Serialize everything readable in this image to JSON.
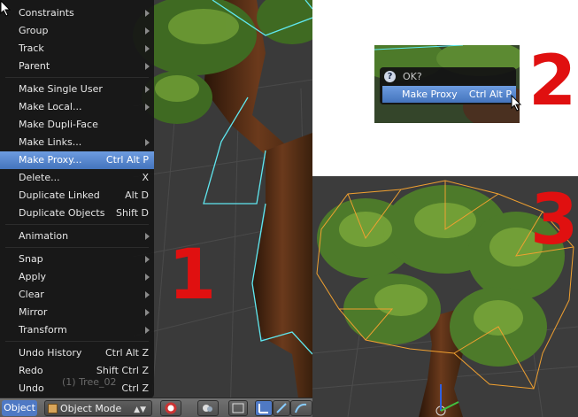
{
  "object_menu": {
    "items": [
      {
        "label": "Constraints",
        "shortcut": "",
        "submenu": true
      },
      {
        "label": "Group",
        "shortcut": "",
        "submenu": true
      },
      {
        "label": "Track",
        "shortcut": "",
        "submenu": true
      },
      {
        "label": "Parent",
        "shortcut": "",
        "submenu": true
      },
      {
        "sep": true
      },
      {
        "label": "Make Single User",
        "shortcut": "",
        "submenu": true
      },
      {
        "label": "Make Local...",
        "shortcut": "",
        "submenu": true
      },
      {
        "label": "Make Dupli-Face",
        "shortcut": "",
        "submenu": false
      },
      {
        "label": "Make Links...",
        "shortcut": "",
        "submenu": true
      },
      {
        "label": "Make Proxy...",
        "shortcut": "Ctrl Alt P",
        "submenu": false,
        "active": true
      },
      {
        "label": "Delete...",
        "shortcut": "X",
        "submenu": false
      },
      {
        "label": "Duplicate Linked",
        "shortcut": "Alt D",
        "submenu": false
      },
      {
        "label": "Duplicate Objects",
        "shortcut": "Shift D",
        "submenu": false
      },
      {
        "sep": true
      },
      {
        "label": "Animation",
        "shortcut": "",
        "submenu": true
      },
      {
        "sep": true
      },
      {
        "label": "Snap",
        "shortcut": "",
        "submenu": true
      },
      {
        "label": "Apply",
        "shortcut": "",
        "submenu": true
      },
      {
        "label": "Clear",
        "shortcut": "",
        "submenu": true
      },
      {
        "label": "Mirror",
        "shortcut": "",
        "submenu": true
      },
      {
        "label": "Transform",
        "shortcut": "",
        "submenu": true
      },
      {
        "sep": true
      },
      {
        "label": "Undo History",
        "shortcut": "Ctrl Alt Z",
        "submenu": false
      },
      {
        "label": "Redo",
        "shortcut": "Shift Ctrl Z",
        "submenu": false
      },
      {
        "label": "Undo",
        "shortcut": "Ctrl Z",
        "submenu": false
      }
    ]
  },
  "viewport": {
    "object_label": "(1) Tree_02"
  },
  "header": {
    "object_menu_label": "Object",
    "mode_label": "Object Mode"
  },
  "popup": {
    "title": "OK?",
    "item_label": "Make Proxy",
    "item_shortcut": "Ctrl Alt P"
  },
  "step_labels": {
    "one": "1",
    "two": "2",
    "three": "3"
  },
  "colors": {
    "menu_highlight": "#5585d0",
    "step_number": "#e01010",
    "selection_outline_cyan": "#5fe8f0",
    "selection_outline_orange": "#f0a030"
  }
}
